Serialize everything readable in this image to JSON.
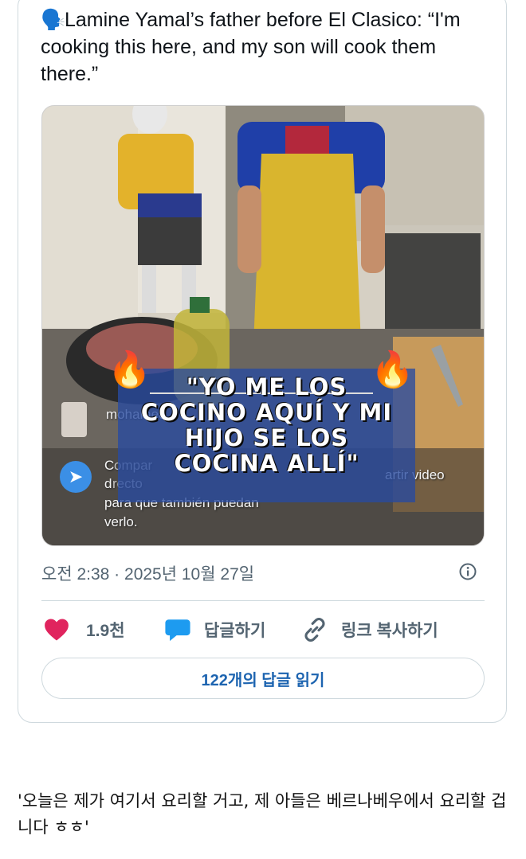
{
  "tweet": {
    "emoji": "🗣️",
    "text": "Lamine Yamal’s father before El Clasico: “I'm cooking this here, and my son will cook them there.”"
  },
  "media": {
    "caption_lines": [
      "\"YO ME LOS",
      "COCINO AQUÍ Y MI",
      "HIJO SE LOS",
      "COCINA ALLÍ\""
    ],
    "overlay": {
      "username": "mohamed",
      "share_prefix": "C",
      "share_text_1": "ompar",
      "share_text_2": "d",
      "share_text_3": "recto",
      "share_right": "artir video",
      "comment_line_1": "para que también puedan",
      "comment_line_2": "verlo."
    }
  },
  "meta": {
    "timestamp": "오전 2:38 · 2025년 10월 27일"
  },
  "actions": {
    "likes": "1.9천",
    "reply": "답글하기",
    "copy_link": "링크 복사하기"
  },
  "read_replies": "122개의 답글 읽기",
  "quote_text": "'오늘은 제가 여기서 요리할 거고, 제 아들은 베르나베우에서 요리할 겁니다 ㅎㅎ'",
  "colors": {
    "like": "#e0245e",
    "reply": "#1d9bf0",
    "accent": "#1d64b0",
    "caption_bg": "#284aa0"
  }
}
